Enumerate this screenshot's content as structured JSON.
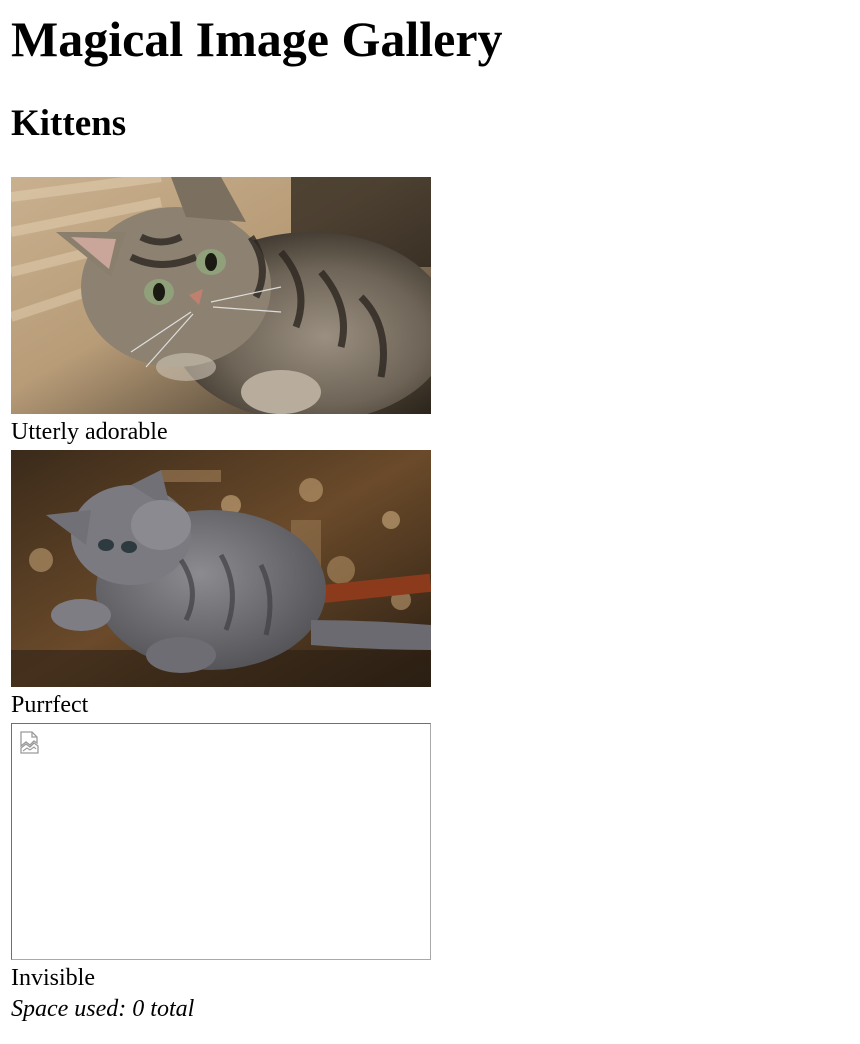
{
  "page": {
    "title": "Magical Image Gallery",
    "section_title": "Kittens"
  },
  "gallery": {
    "items": [
      {
        "caption": "Utterly adorable",
        "image": "tabby-kitten-lying-on-rug"
      },
      {
        "caption": "Purrfect",
        "image": "gray-kitten-playing-on-patterned-rug"
      },
      {
        "caption": "Invisible",
        "image": "broken-image-icon"
      }
    ]
  },
  "footer": {
    "space_used": "Space used: 0 total"
  }
}
